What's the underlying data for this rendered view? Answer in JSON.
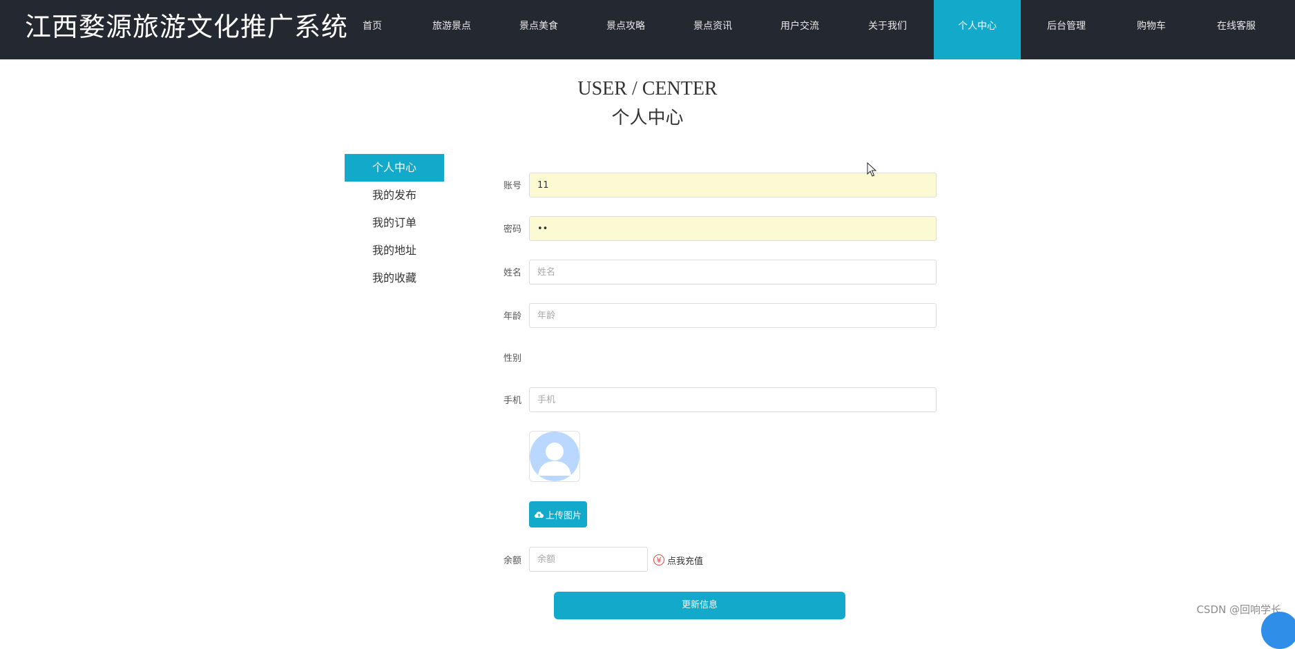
{
  "brand": "江西婺源旅游文化推广系统",
  "nav": {
    "items": [
      {
        "label": "首页",
        "active": false
      },
      {
        "label": "旅游景点",
        "active": false
      },
      {
        "label": "景点美食",
        "active": false
      },
      {
        "label": "景点攻略",
        "active": false
      },
      {
        "label": "景点资讯",
        "active": false
      },
      {
        "label": "用户交流",
        "active": false
      },
      {
        "label": "关于我们",
        "active": false
      },
      {
        "label": "个人中心",
        "active": true
      },
      {
        "label": "后台管理",
        "active": false
      },
      {
        "label": "购物车",
        "active": false
      },
      {
        "label": "在线客服",
        "active": false
      }
    ]
  },
  "page_head": {
    "en": "USER / CENTER",
    "cn": "个人中心"
  },
  "side_menu": {
    "items": [
      {
        "label": "个人中心",
        "active": true
      },
      {
        "label": "我的发布",
        "active": false
      },
      {
        "label": "我的订单",
        "active": false
      },
      {
        "label": "我的地址",
        "active": false
      },
      {
        "label": "我的收藏",
        "active": false
      }
    ]
  },
  "form": {
    "account": {
      "label": "账号",
      "value": "11"
    },
    "password": {
      "label": "密码",
      "value": "11"
    },
    "name": {
      "label": "姓名",
      "placeholder": "姓名",
      "value": ""
    },
    "age": {
      "label": "年龄",
      "placeholder": "年龄",
      "value": ""
    },
    "gender": {
      "label": "性别"
    },
    "phone": {
      "label": "手机",
      "placeholder": "手机",
      "value": ""
    },
    "upload_label": "上传图片",
    "balance": {
      "label": "余额",
      "placeholder": "余额",
      "value": ""
    },
    "recharge_label": "点我充值",
    "submit_label": "更新信息"
  },
  "watermark": "CSDN @回响学长",
  "colors": {
    "accent": "#12a9cb",
    "topbar": "#242831",
    "filled_input": "#fbfad2"
  }
}
